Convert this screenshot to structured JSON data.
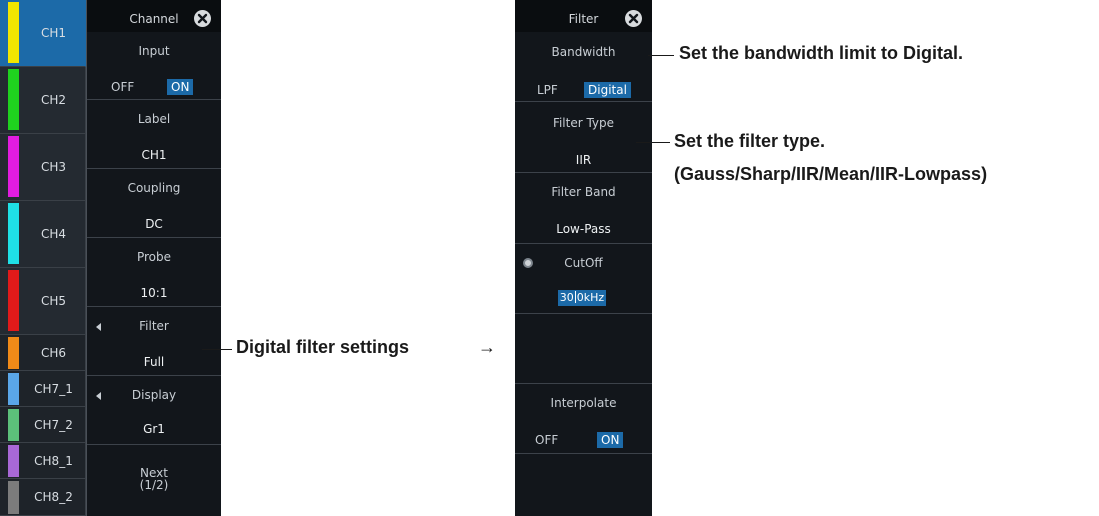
{
  "tabs": [
    {
      "label": "CH1",
      "color": "#f2e600",
      "active": true
    },
    {
      "label": "CH2",
      "color": "#1fd21f"
    },
    {
      "label": "CH3",
      "color": "#e21ce0"
    },
    {
      "label": "CH4",
      "color": "#1fe0e6"
    },
    {
      "label": "CH5",
      "color": "#e01a1a"
    },
    {
      "label": "CH6",
      "color": "#f08a18"
    },
    {
      "label": "CH7_1",
      "color": "#5aa6e8"
    },
    {
      "label": "CH7_2",
      "color": "#5cc07a"
    },
    {
      "label": "CH8_1",
      "color": "#a868d6"
    },
    {
      "label": "CH8_2",
      "color": "#7c7c7c"
    }
  ],
  "channel_menu": {
    "title": "Channel",
    "input": {
      "caption": "Input",
      "off": "OFF",
      "on": "ON",
      "selected": "ON"
    },
    "label": {
      "caption": "Label",
      "value": "CH1"
    },
    "coupling": {
      "caption": "Coupling",
      "value": "DC"
    },
    "probe": {
      "caption": "Probe",
      "value": "10:1"
    },
    "filter": {
      "caption": "Filter",
      "value": "Full"
    },
    "display": {
      "caption": "Display",
      "value": "Gr1"
    },
    "next": {
      "line1": "Next",
      "line2": "(1/2)"
    }
  },
  "filter_menu": {
    "title": "Filter",
    "bandwidth": {
      "caption": "Bandwidth",
      "lpf": "LPF",
      "digital": "Digital",
      "selected": "Digital"
    },
    "filter_type": {
      "caption": "Filter Type",
      "value": "IIR"
    },
    "filter_band": {
      "caption": "Filter Band",
      "value": "Low-Pass"
    },
    "cutoff": {
      "caption": "CutOff",
      "value_a": "30",
      "value_b": "0",
      "unit": "kHz"
    },
    "interpolate": {
      "caption": "Interpolate",
      "off": "OFF",
      "on": "ON",
      "selected": "ON"
    }
  },
  "annotations": {
    "bandwidth_note": "Set the bandwidth limit to Digital.",
    "filter_type_note_1": "Set the filter type.",
    "filter_type_note_2": "(Gauss/Sharp/IIR/Mean/IIR-Lowpass)",
    "digital_filter_note": "Digital filter settings",
    "arrow": "→"
  }
}
